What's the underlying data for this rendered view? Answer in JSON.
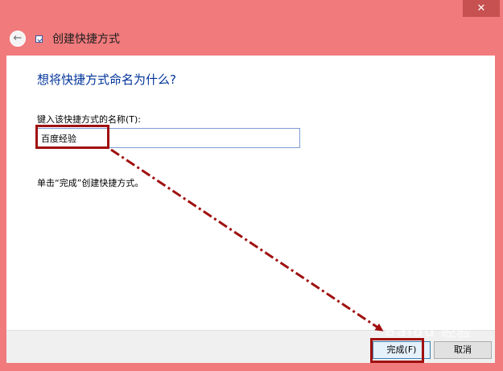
{
  "window": {
    "close_glyph": "✕",
    "back_glyph": "←",
    "title": "创建快捷方式"
  },
  "content": {
    "heading": "想将快捷方式命名为什么?",
    "field_label": "键入该快捷方式的名称(T):",
    "name_value": "百度经验",
    "hint": "单击“完成”创建快捷方式。"
  },
  "buttons": {
    "finish": "完成(F)",
    "cancel": "取消"
  },
  "colors": {
    "chrome": "#f07a7c",
    "heading": "#003399",
    "annotation": "#a01010"
  },
  "watermark_text": "Baidu 经验"
}
